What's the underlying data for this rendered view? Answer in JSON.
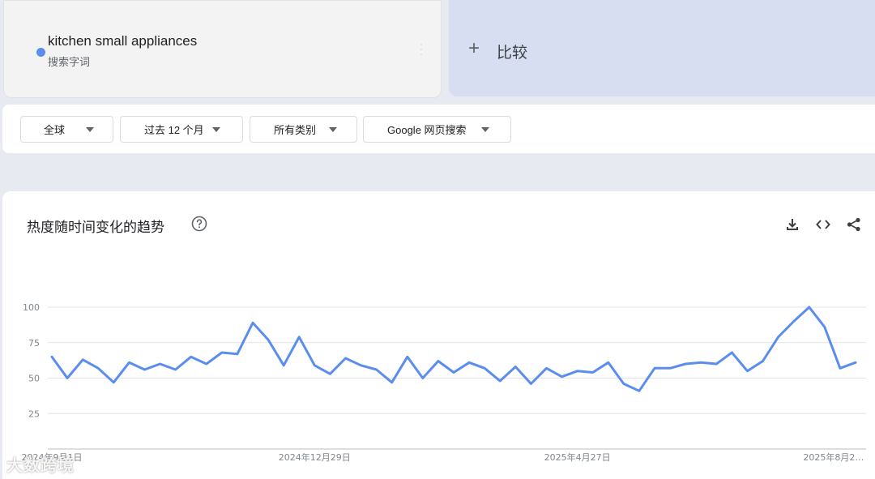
{
  "term": {
    "name": "kitchen small appliances",
    "type": "搜索字词",
    "color": "#5b8def"
  },
  "compare": {
    "icon": "plus-icon",
    "label": "比较"
  },
  "filters": {
    "region": "全球",
    "time": "过去 12 个月",
    "category": "所有类别",
    "property": "Google 网页搜索"
  },
  "chart_card": {
    "title": "热度随时间变化的趋势",
    "icons": [
      "help-icon",
      "download-icon",
      "embed-icon",
      "share-icon"
    ]
  },
  "chart_data": {
    "type": "line",
    "title": "",
    "ylim": [
      0,
      100
    ],
    "yticks": [
      100,
      75,
      50,
      25
    ],
    "x_tick_labels": [
      "2024年9月1日",
      "2024年12月29日",
      "2025年4月27日",
      "2025年8月2…"
    ],
    "grid": true,
    "series": [
      {
        "name": "kitchen small appliances",
        "color": "#5b8def",
        "values": [
          65,
          50,
          63,
          57,
          47,
          61,
          56,
          60,
          56,
          65,
          60,
          68,
          67,
          89,
          77,
          59,
          79,
          59,
          53,
          64,
          59,
          56,
          47,
          65,
          50,
          62,
          54,
          61,
          57,
          48,
          58,
          46,
          57,
          51,
          55,
          54,
          61,
          46,
          41,
          57,
          57,
          60,
          61,
          60,
          68,
          55,
          62,
          79,
          90,
          100,
          86,
          57,
          61
        ]
      }
    ]
  },
  "watermark": "大数跨境"
}
